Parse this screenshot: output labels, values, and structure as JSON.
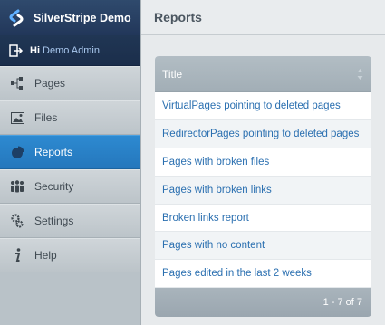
{
  "brand": {
    "title": "SilverStripe Demo",
    "logo_icon": "silverstripe-logo-icon"
  },
  "user": {
    "greeting": "Hi",
    "name": "Demo Admin"
  },
  "menu": [
    {
      "label": "Pages",
      "icon": "sitetree-icon"
    },
    {
      "label": "Files",
      "icon": "image-icon"
    },
    {
      "label": "Reports",
      "icon": "pie-chart-icon",
      "active": true
    },
    {
      "label": "Security",
      "icon": "users-icon"
    },
    {
      "label": "Settings",
      "icon": "gears-icon"
    },
    {
      "label": "Help",
      "icon": "info-icon"
    }
  ],
  "main": {
    "title": "Reports"
  },
  "grid": {
    "column_title": "Title",
    "rows": [
      "VirtualPages pointing to deleted pages",
      "RedirectorPages pointing to deleted pages",
      "Pages with broken files",
      "Pages with broken links",
      "Broken links report",
      "Pages with no content",
      "Pages edited in the last 2 weeks"
    ],
    "pagination": "1 - 7 of 7"
  },
  "colors": {
    "accent": "#2a84cb",
    "brand_bg": "#2a4368",
    "link": "#2a6fb0"
  }
}
